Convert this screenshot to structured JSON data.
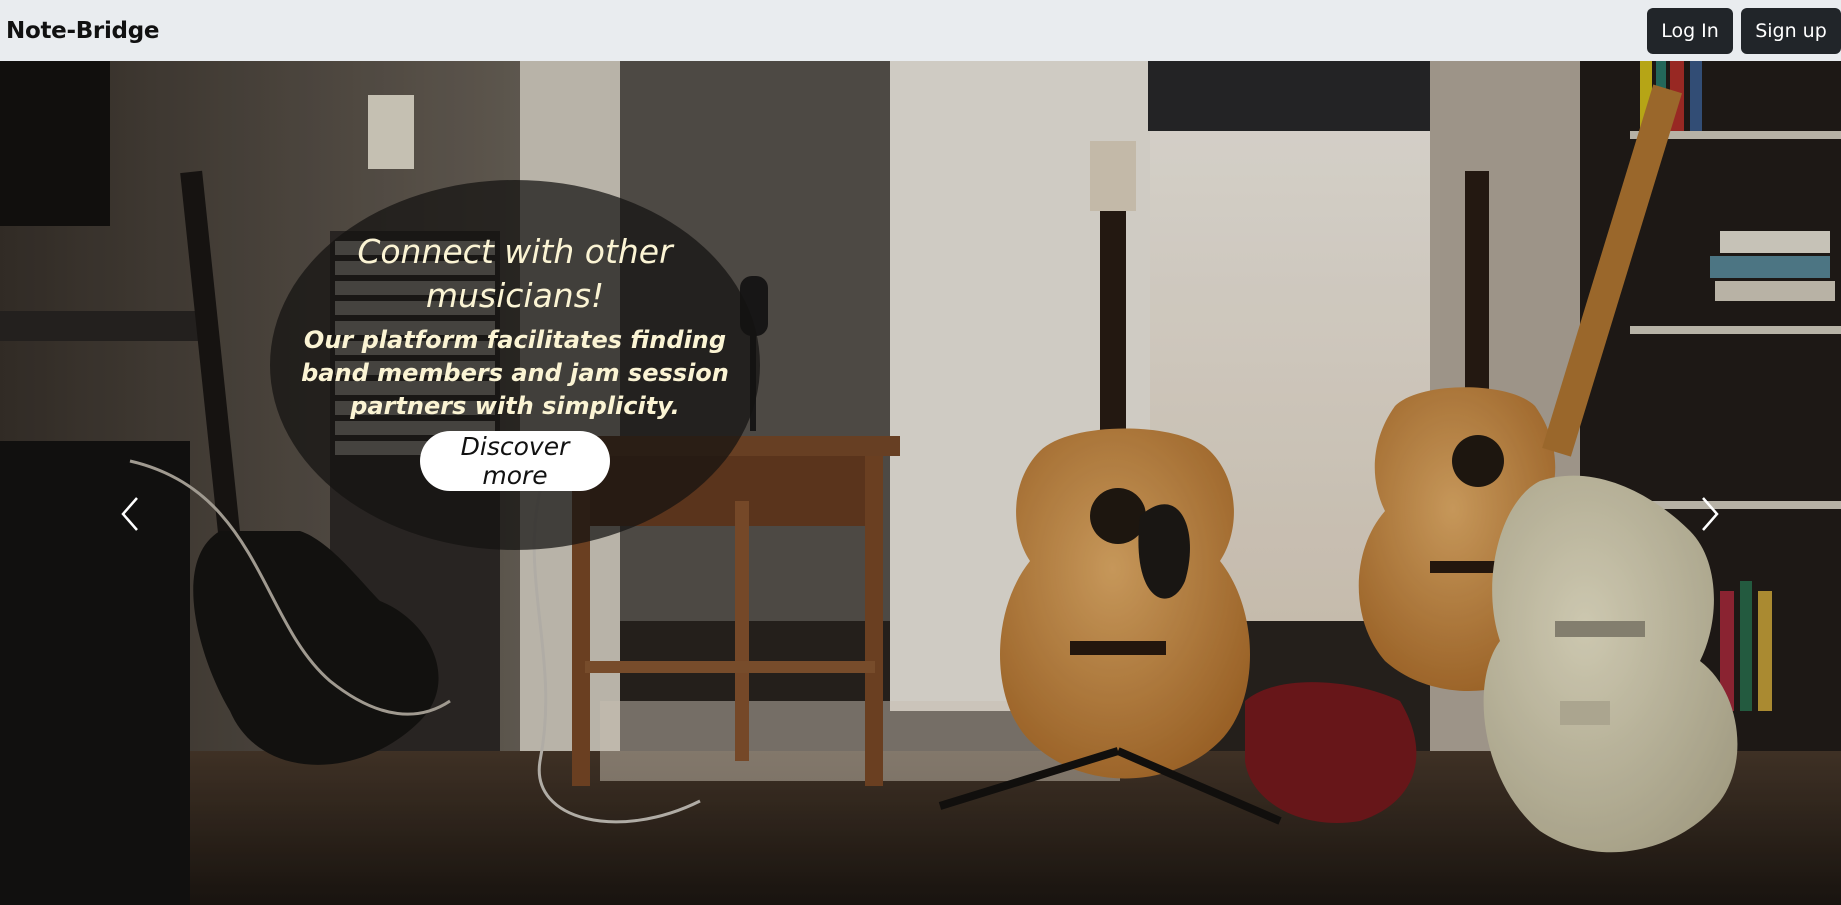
{
  "navbar": {
    "brand": "Note-Bridge",
    "login_label": "Log In",
    "signup_label": "Sign up"
  },
  "hero": {
    "title": "Connect with other musicians!",
    "text": "Our platform facilitates finding band members and jam session partners with simplicity.",
    "cta_label": "Discover more",
    "prev_icon": "chevron-left-icon",
    "next_icon": "chevron-right-icon"
  },
  "colors": {
    "navbar_bg": "#e9ecef",
    "button_bg": "#212529",
    "caption_text": "#fbf4d4",
    "caption_bg": "rgba(20,18,16,0.72)"
  }
}
